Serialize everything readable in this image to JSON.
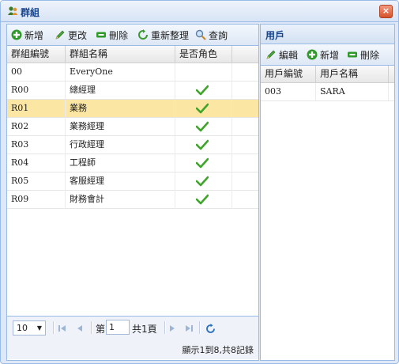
{
  "window": {
    "title": "群組"
  },
  "left": {
    "toolbar": {
      "add": "新增",
      "edit": "更改",
      "delete": "刪除",
      "refresh": "重新整理",
      "search": "查詢"
    },
    "columns": [
      "群組編號",
      "群組名稱",
      "是否角色"
    ],
    "rows": [
      {
        "code": "00",
        "name": "EveryOne",
        "role": false,
        "selected": false
      },
      {
        "code": "R00",
        "name": "總經理",
        "role": true,
        "selected": false
      },
      {
        "code": "R01",
        "name": "業務",
        "role": true,
        "selected": true
      },
      {
        "code": "R02",
        "name": "業務經理",
        "role": true,
        "selected": false
      },
      {
        "code": "R03",
        "name": "行政經理",
        "role": true,
        "selected": false
      },
      {
        "code": "R04",
        "name": "工程師",
        "role": true,
        "selected": false
      },
      {
        "code": "R05",
        "name": "客服經理",
        "role": true,
        "selected": false
      },
      {
        "code": "R09",
        "name": "財務會計",
        "role": true,
        "selected": false
      }
    ],
    "pager": {
      "page_size": "10",
      "page_prefix": "第",
      "page_value": "1",
      "page_suffix": "共1頁",
      "info": "顯示1到8,共8記錄"
    }
  },
  "right": {
    "title": "用戶",
    "toolbar": {
      "edit": "編輯",
      "add": "新增",
      "delete": "刪除"
    },
    "columns": [
      "用戶編號",
      "用戶名稱"
    ],
    "rows": [
      {
        "code": "003",
        "name": "SARA"
      }
    ]
  },
  "colors": {
    "accent": "#15428b",
    "border": "#99bbe8",
    "selected_row": "#fbe6a3",
    "check": "#3fa52a"
  }
}
